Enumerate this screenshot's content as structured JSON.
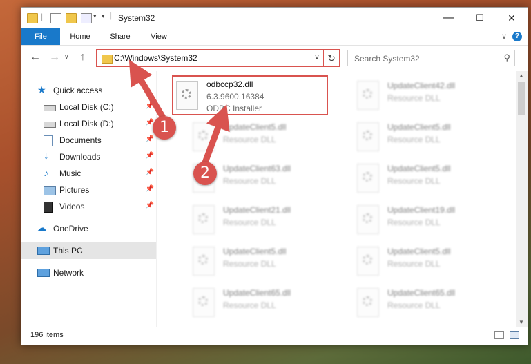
{
  "window": {
    "title": "System32",
    "minimize_glyph": "—",
    "maximize_glyph": "☐",
    "close_glyph": "✕"
  },
  "ribbon": {
    "tabs": [
      "File",
      "Home",
      "Share",
      "View"
    ],
    "collapse_glyph": "∨",
    "help_glyph": "?"
  },
  "navbar": {
    "back_glyph": "←",
    "forward_glyph": "→",
    "recent_glyph": "∨",
    "up_glyph": "↑",
    "address": "C:\\Windows\\System32",
    "address_dropdown_glyph": "∨",
    "refresh_glyph": "↻",
    "search_placeholder": "Search System32",
    "search_glyph": "⚲"
  },
  "sidebar": {
    "quick_access": "Quick access",
    "items": [
      {
        "label": "Local Disk (C:)",
        "icon": "drive-icon"
      },
      {
        "label": "Local Disk (D:)",
        "icon": "drive-icon"
      },
      {
        "label": "Documents",
        "icon": "documents-icon"
      },
      {
        "label": "Downloads",
        "icon": "downloads-icon"
      },
      {
        "label": "Music",
        "icon": "music-icon"
      },
      {
        "label": "Pictures",
        "icon": "pictures-icon"
      },
      {
        "label": "Videos",
        "icon": "videos-icon"
      }
    ],
    "pin_glyph": "📌",
    "onedrive": "OneDrive",
    "this_pc": "This PC",
    "network": "Network"
  },
  "files": [
    {
      "name": "odbccp32.dll",
      "line2": "6.3.9600.16384",
      "line3": "ODBC Installer"
    },
    {
      "name": "UpdateClient42.dll",
      "line2": "Resource DLL"
    },
    {
      "name": "UpdateClient5.dll",
      "line2": "Resource DLL"
    },
    {
      "name": "UpdateClient5.dll",
      "line2": "Resource DLL"
    },
    {
      "name": "UpdateClient63.dll",
      "line2": "Resource DLL"
    },
    {
      "name": "UpdateClient5.dll",
      "line2": "Resource DLL"
    },
    {
      "name": "UpdateClient21.dll",
      "line2": "Resource DLL"
    },
    {
      "name": "UpdateClient19.dll",
      "line2": "Resource DLL"
    },
    {
      "name": "UpdateClient5.dll",
      "line2": "Resource DLL"
    },
    {
      "name": "UpdateClient5.dll",
      "line2": "Resource DLL"
    },
    {
      "name": "UpdateClient65.dll",
      "line2": "Resource DLL"
    },
    {
      "name": "UpdateClient65.dll",
      "line2": "Resource DLL"
    }
  ],
  "status": {
    "item_count": "196 items"
  },
  "annotations": {
    "step1": "1",
    "step2": "2"
  },
  "colors": {
    "accent": "#1979ca",
    "highlight": "#d9534f"
  }
}
